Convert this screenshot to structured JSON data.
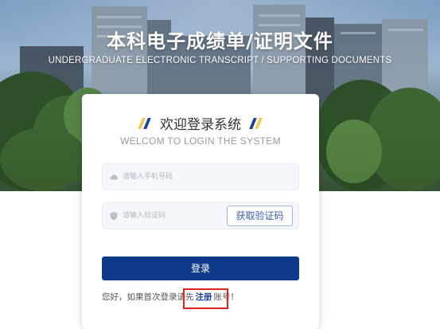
{
  "header": {
    "title_cn": "本科电子成绩单/证明文件",
    "title_en": "UNDERGRADUATE ELECTRONIC TRANSCRIPT / SUPPORTING DOCUMENTS"
  },
  "login": {
    "title": "欢迎登录系统",
    "subtitle": "WELCOM TO LOGIN THE SYSTEM",
    "phone_placeholder": "请输入手机号码",
    "phone_value": "",
    "phone_icon": "cloud-icon",
    "code_placeholder": "请输入验证码",
    "code_value": "",
    "code_icon": "shield-icon",
    "get_code_label": "获取验证码",
    "submit_label": "登录",
    "register_prefix": "您好，如果首次登录请先",
    "register_link": "注册",
    "register_suffix": "账号！"
  },
  "colors": {
    "primary": "#0e3a8c",
    "highlight_box": "#e0241b",
    "slash_yellow": "#f2c94c",
    "slash_blue": "#1f3f9c"
  }
}
